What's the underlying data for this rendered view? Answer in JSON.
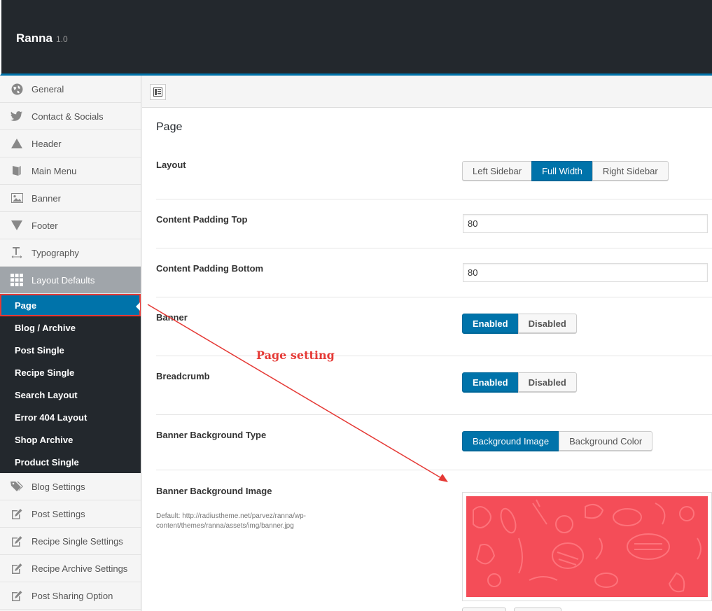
{
  "app": {
    "title": "Ranna",
    "version": "1.0"
  },
  "sidebar": {
    "items": [
      {
        "label": "General",
        "icon": "globe-icon"
      },
      {
        "label": "Contact & Socials",
        "icon": "twitter-icon"
      },
      {
        "label": "Header",
        "icon": "triangle-up-icon"
      },
      {
        "label": "Main Menu",
        "icon": "book-icon"
      },
      {
        "label": "Banner",
        "icon": "image-icon"
      },
      {
        "label": "Footer",
        "icon": "triangle-down-icon"
      },
      {
        "label": "Typography",
        "icon": "text-icon"
      },
      {
        "label": "Layout Defaults",
        "icon": "grid-icon"
      }
    ],
    "subitems": [
      {
        "label": "Page"
      },
      {
        "label": "Blog / Archive"
      },
      {
        "label": "Post Single"
      },
      {
        "label": "Recipe Single"
      },
      {
        "label": "Search Layout"
      },
      {
        "label": "Error 404 Layout"
      },
      {
        "label": "Shop Archive"
      },
      {
        "label": "Product Single"
      }
    ],
    "items_after": [
      {
        "label": "Blog Settings",
        "icon": "tags-icon"
      },
      {
        "label": "Post Settings",
        "icon": "edit-icon"
      },
      {
        "label": "Recipe Single Settings",
        "icon": "edit-icon"
      },
      {
        "label": "Recipe Archive Settings",
        "icon": "edit-icon"
      },
      {
        "label": "Post Sharing Option",
        "icon": "edit-icon"
      }
    ]
  },
  "main": {
    "section_title": "Page",
    "layout": {
      "label": "Layout",
      "options": [
        "Left Sidebar",
        "Full Width",
        "Right Sidebar"
      ],
      "selected": "Full Width"
    },
    "padding_top": {
      "label": "Content Padding Top",
      "value": "80"
    },
    "padding_bottom": {
      "label": "Content Padding Bottom",
      "value": "80"
    },
    "banner": {
      "label": "Banner",
      "options": [
        "Enabled",
        "Disabled"
      ],
      "selected": "Enabled"
    },
    "breadcrumb": {
      "label": "Breadcrumb",
      "options": [
        "Enabled",
        "Disabled"
      ],
      "selected": "Enabled"
    },
    "banner_bg_type": {
      "label": "Banner Background Type",
      "options": [
        "Background Image",
        "Background Color"
      ],
      "selected": "Background Image"
    },
    "banner_bg_image": {
      "label": "Banner Background Image",
      "description": "Default: http://radiustheme.net/parvez/ranna/wp-content/themes/ranna/assets/img/banner.jpg"
    }
  },
  "annotation": {
    "text": "Page setting",
    "color": "#e53935"
  },
  "colors": {
    "accent": "#0073aa",
    "adminbar": "#23282d",
    "banner": "#f44d58"
  }
}
